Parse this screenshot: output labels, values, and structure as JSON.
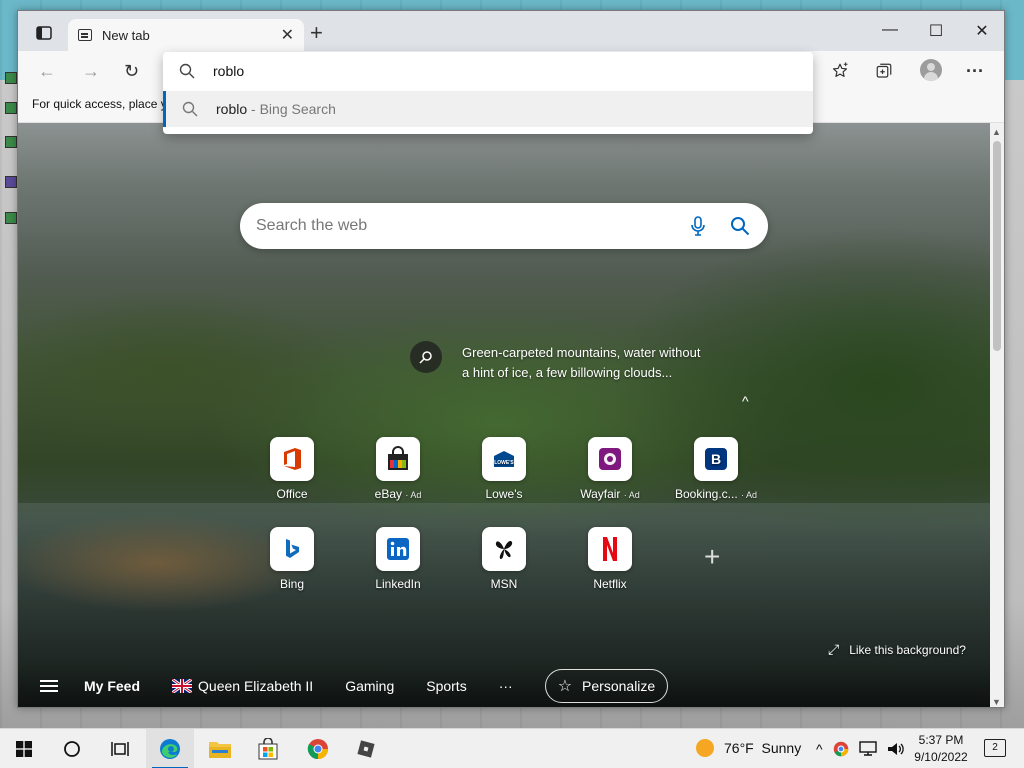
{
  "browser": {
    "tab": {
      "title": "New tab",
      "close": "✕"
    },
    "new_tab": "+",
    "window_controls": {
      "minimize": "—",
      "maximize": "☐",
      "close": "✕"
    },
    "nav": {
      "back": "←",
      "forward": "→",
      "refresh": "↻",
      "more": "···"
    },
    "favorites_bar_text": "For quick access, place y"
  },
  "omnibox": {
    "value": "roblo",
    "suggestion": {
      "text": "roblo",
      "source": "- Bing Search"
    }
  },
  "newtab": {
    "search_placeholder": "Search the web",
    "background_caption": "Green-carpeted mountains, water without a hint of ice, a few billowing clouds...",
    "collapse": "^",
    "tiles": [
      {
        "label": "Office",
        "ad": ""
      },
      {
        "label": "eBay",
        "ad": "· Ad"
      },
      {
        "label": "Lowe's",
        "ad": ""
      },
      {
        "label": "Wayfair",
        "ad": "· Ad"
      },
      {
        "label": "Booking.c...",
        "ad": "· Ad"
      },
      {
        "label": "Bing",
        "ad": ""
      },
      {
        "label": "LinkedIn",
        "ad": ""
      },
      {
        "label": "MSN",
        "ad": ""
      },
      {
        "label": "Netflix",
        "ad": ""
      }
    ],
    "add_tile": "+",
    "like_background": "Like this background?",
    "feed": {
      "my_feed": "My Feed",
      "queen": "Queen Elizabeth II",
      "gaming": "Gaming",
      "sports": "Sports",
      "more": "···",
      "personalize": "Personalize"
    }
  },
  "taskbar": {
    "weather": {
      "temp": "76°F",
      "condition": "Sunny"
    },
    "clock": {
      "time": "5:37 PM",
      "date": "9/10/2022"
    },
    "notifications": "2"
  },
  "colors": {
    "accent": "#0067c0",
    "office": "#d83b01",
    "netflix": "#e50914",
    "booking": "#003580",
    "linkedin": "#0a66c2"
  }
}
